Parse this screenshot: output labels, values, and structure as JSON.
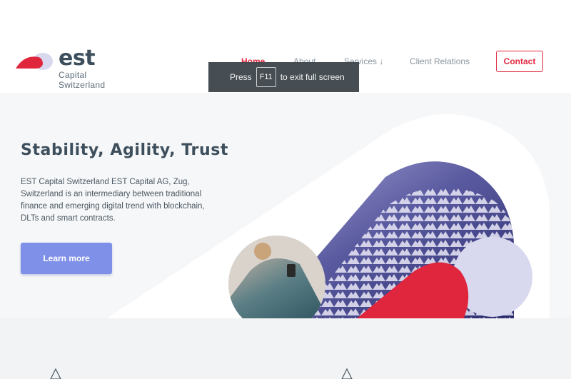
{
  "brand": {
    "name": "est",
    "subtitle": "Capital Switzerland",
    "colors": {
      "accent": "#e0263d",
      "dark": "#3d4f5c",
      "lavender": "#d8d9ef",
      "button": "#7f90e8"
    }
  },
  "nav": {
    "items": [
      {
        "label": "Home",
        "active": true
      },
      {
        "label": "About",
        "active": false
      },
      {
        "label": "Services ↓",
        "active": false
      },
      {
        "label": "Client Relations",
        "active": false
      }
    ],
    "contact_label": "Contact"
  },
  "overlay": {
    "press": "Press",
    "key": "F11",
    "suffix": "to exit full screen"
  },
  "hero": {
    "title": "Stability, Agility, Trust",
    "text": "EST Capital Switzerland EST Capital AG, Zug, Switzerland is an intermediary between traditional finance and emerging digital trend with blockchain, DLTs and smart contracts.",
    "button_label": "Learn more",
    "images": [
      "mountain-range-photo",
      "person-with-phone-photo"
    ]
  },
  "bottom": {
    "icons": [
      "triangle-icon",
      "triangle-icon"
    ]
  }
}
